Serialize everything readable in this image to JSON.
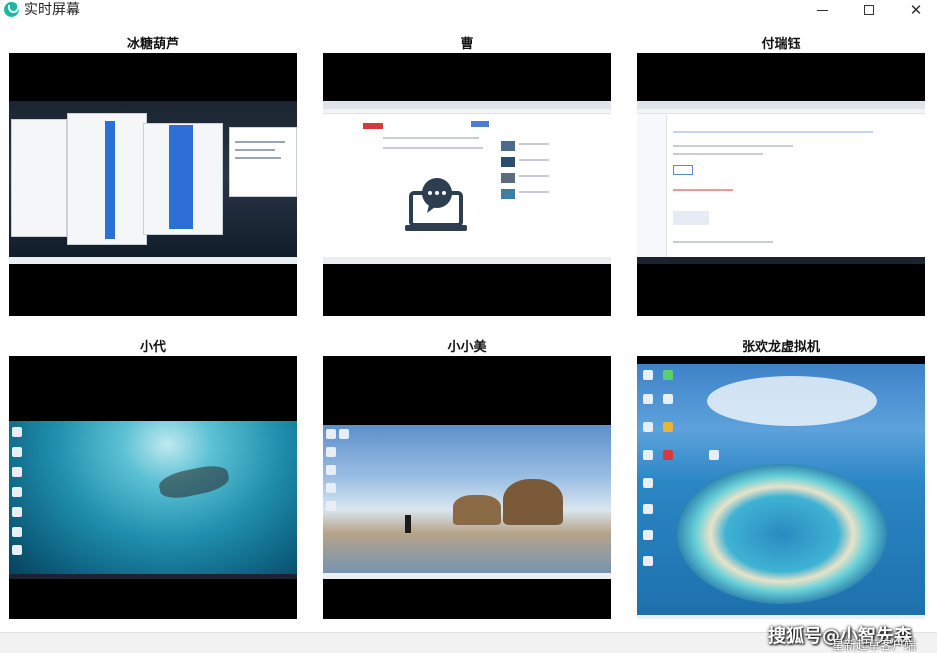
{
  "window": {
    "title": "实时屏幕",
    "icon": "monitor-app-icon",
    "controls": {
      "minimize": "minimize-icon",
      "maximize": "maximize-icon",
      "close": "close-icon"
    }
  },
  "tiles": [
    {
      "label": "冰糖葫芦"
    },
    {
      "label": "曹"
    },
    {
      "label": "付瑞钰"
    },
    {
      "label": "小代"
    },
    {
      "label": "小小美"
    },
    {
      "label": "张欢龙虚拟机"
    }
  ],
  "watermark": {
    "text": "搜狐号@小智先森",
    "subtext": "星新起草客户端"
  },
  "colors": {
    "accent": "#1fb6a4",
    "tile_bg": "#000000"
  }
}
